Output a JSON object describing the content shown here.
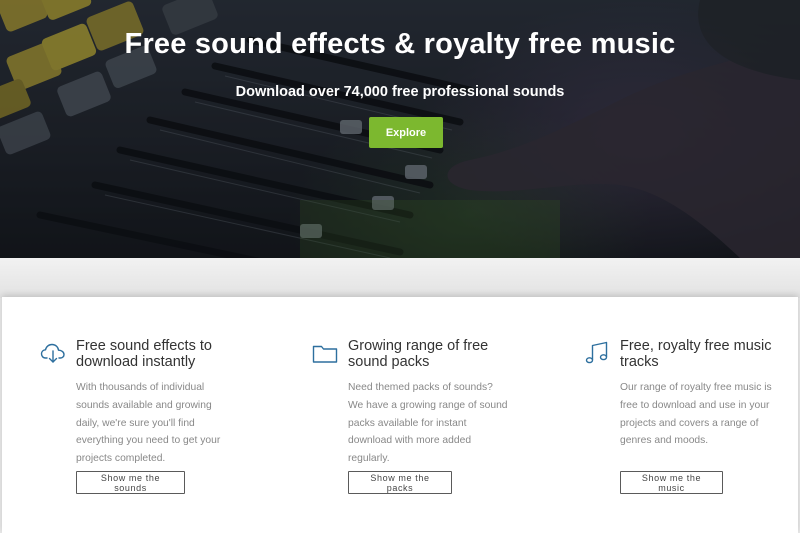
{
  "hero": {
    "title": "Free sound effects & royalty free music",
    "subtitle": "Download over 74,000 free professional sounds",
    "explore_label": "Explore",
    "accent_color": "#7cb82f",
    "background": "mixing-desk-photo"
  },
  "features": [
    {
      "icon": "cloud-download-icon",
      "title_line1": "Free sound effects to",
      "title_line2": "download instantly",
      "description": "With thousands of individual sounds available and growing daily, we're sure you'll find everything you need to get your projects completed.",
      "button_label": "Show me the sounds"
    },
    {
      "icon": "folder-icon",
      "title_line1": "Growing range of free",
      "title_line2": "sound packs",
      "description": "Need themed packs of sounds? We have a growing range of sound packs available for instant download with more added regularly.",
      "button_label": "Show me the packs"
    },
    {
      "icon": "music-note-icon",
      "title_line1": "Free, royalty free music",
      "title_line2": "tracks",
      "description": "Our range of royalty free music is free to download and use in your projects and covers a range of genres and moods.",
      "button_label": "Show me the music"
    }
  ],
  "colors": {
    "icon": "#2d6f9e",
    "button_border": "#5a5a5a"
  }
}
